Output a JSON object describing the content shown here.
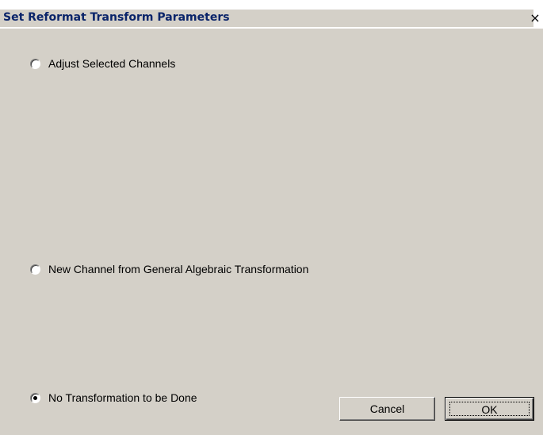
{
  "window": {
    "title": "Set Reformat Transform Parameters",
    "close_label": "×"
  },
  "options": [
    {
      "label": "Adjust Selected Channels",
      "checked": false
    },
    {
      "label": "New Channel from General Algebraic Transformation",
      "checked": false
    },
    {
      "label": "No Transformation to be Done",
      "checked": true
    }
  ],
  "buttons": {
    "cancel_label": "Cancel",
    "ok_label": "OK"
  },
  "colors": {
    "face": "#d4d0c8",
    "title_text": "#0a246a"
  }
}
